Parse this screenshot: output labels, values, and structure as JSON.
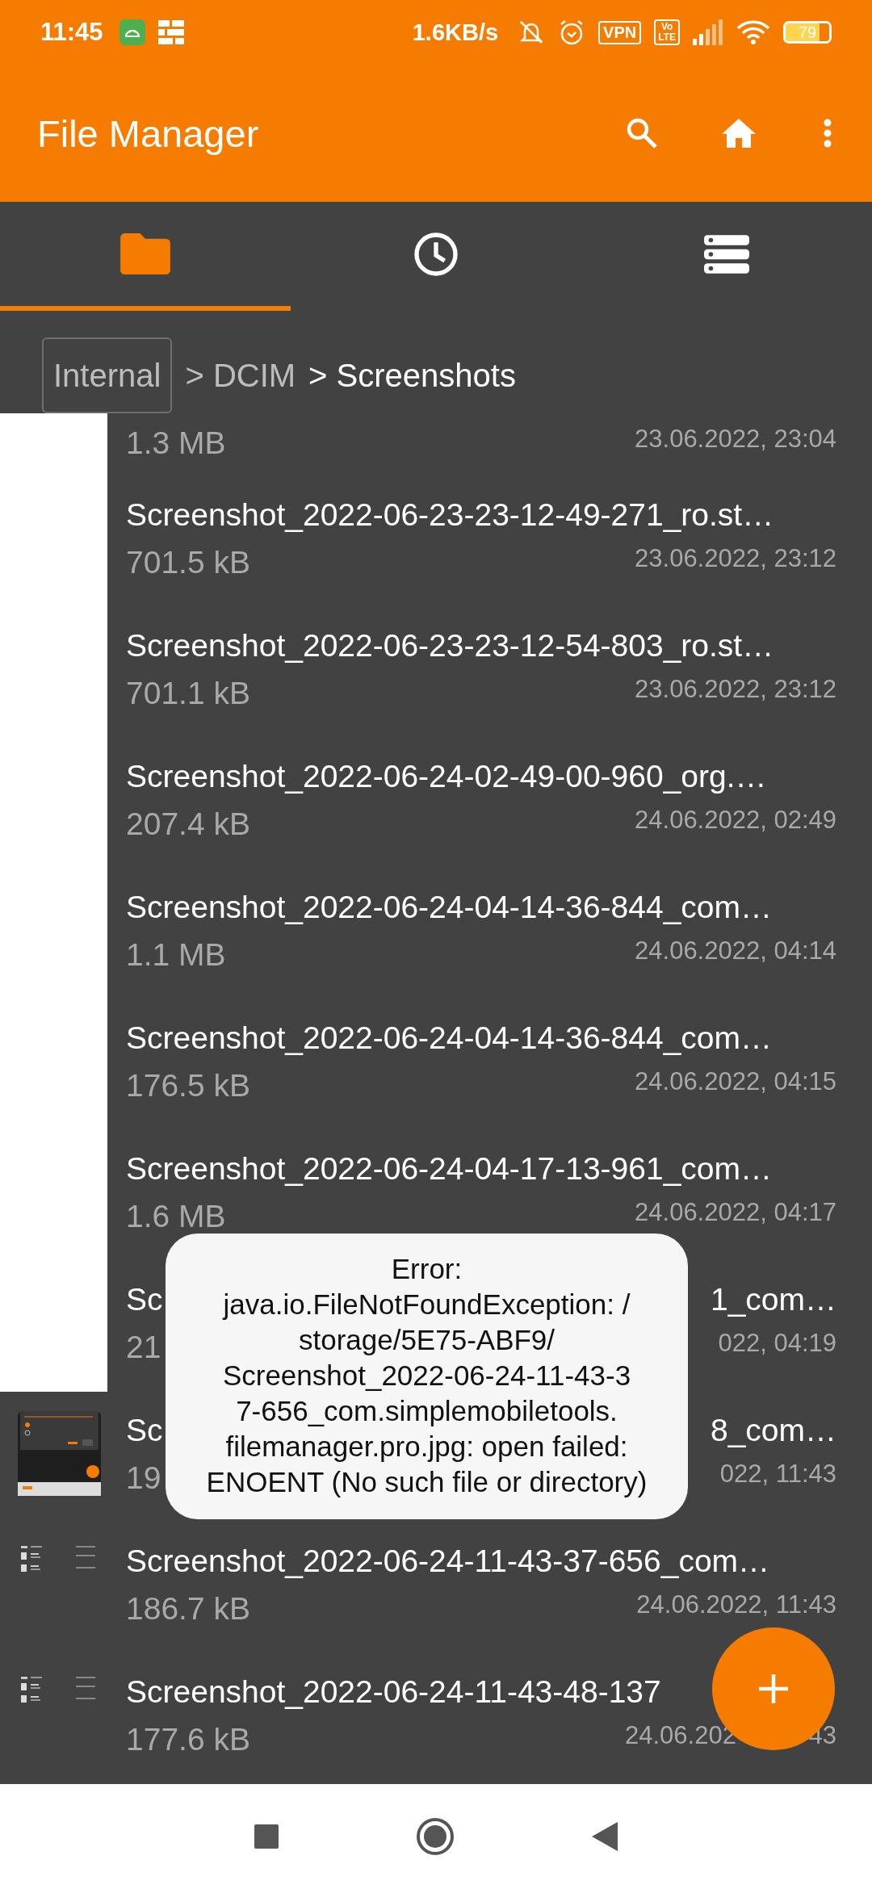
{
  "status_bar": {
    "time": "11:45",
    "speed": "1.6KB/s",
    "vpn": "VPN",
    "volte_top": "Vo",
    "volte_bottom": "LTE",
    "battery": "79"
  },
  "app_bar": {
    "title": "File Manager"
  },
  "tabs": [
    {
      "selected": true
    },
    {
      "selected": false
    },
    {
      "selected": false
    }
  ],
  "breadcrumbs": [
    {
      "label": "Internal",
      "kind": "root",
      "current": false
    },
    {
      "label": "> DCIM",
      "kind": "crumb",
      "current": false
    },
    {
      "label": "> Screenshots",
      "kind": "crumb",
      "current": true
    }
  ],
  "files": [
    {
      "thumbnail": {
        "kind": "blank"
      },
      "kind": "clipped",
      "size": "1.3 MB",
      "date": "23.06.2022, 23:04"
    },
    {
      "thumbnail": {
        "kind": "blank"
      },
      "kind": "full",
      "name": "Screenshot_2022-06-23-23-12-49-271_ro.st…",
      "size": "701.5 kB",
      "date": "23.06.2022, 23:12"
    },
    {
      "thumbnail": {
        "kind": "blank"
      },
      "kind": "full",
      "name": "Screenshot_2022-06-23-23-12-54-803_ro.st…",
      "size": "701.1 kB",
      "date": "23.06.2022, 23:12"
    },
    {
      "thumbnail": {
        "kind": "blank"
      },
      "kind": "full",
      "name": "Screenshot_2022-06-24-02-49-00-960_org.…",
      "size": "207.4 kB",
      "date": "24.06.2022, 02:49"
    },
    {
      "thumbnail": {
        "kind": "blank"
      },
      "kind": "full",
      "name": "Screenshot_2022-06-24-04-14-36-844_com…",
      "size": "1.1 MB",
      "date": "24.06.2022, 04:14"
    },
    {
      "thumbnail": {
        "kind": "blank"
      },
      "kind": "full",
      "name": "Screenshot_2022-06-24-04-14-36-844_com…",
      "size": "176.5 kB",
      "date": "24.06.2022, 04:15"
    },
    {
      "thumbnail": {
        "kind": "blank"
      },
      "kind": "full",
      "name": "Screenshot_2022-06-24-04-17-13-961_com…",
      "size": "1.6 MB",
      "date": "24.06.2022, 04:17"
    },
    {
      "thumbnail": {
        "kind": "blank"
      },
      "kind": "covered",
      "name_parts": [
        "Sc",
        "1_com…"
      ],
      "size": "21",
      "date": "022, 04:19"
    },
    {
      "thumbnail": {
        "kind": "screen"
      },
      "kind": "covered",
      "name_parts": [
        "Sc",
        "8_com…"
      ],
      "size": "19",
      "date": "022, 11:43"
    },
    {
      "thumbnail": {
        "kind": "list"
      },
      "kind": "full",
      "name": "Screenshot_2022-06-24-11-43-37-656_com…",
      "size": "186.7 kB",
      "date": "24.06.2022, 11:43"
    },
    {
      "thumbnail": {
        "kind": "list"
      },
      "kind": "covered_end",
      "name": "Screenshot_2022-06-24-11-43-48-137",
      "size": "177.6 kB",
      "date_parts": [
        "24.06.202",
        "43"
      ]
    }
  ],
  "toast": {
    "message_lines": [
      "Error:",
      "java.io.FileNotFoundException: /",
      "storage/5E75-ABF9/",
      "Screenshot_2022-06-24-11-43-3",
      "7-656_com.simplemobiletools.",
      "filemanager.pro.jpg: open failed:",
      "ENOENT (No such file or directory)"
    ]
  }
}
